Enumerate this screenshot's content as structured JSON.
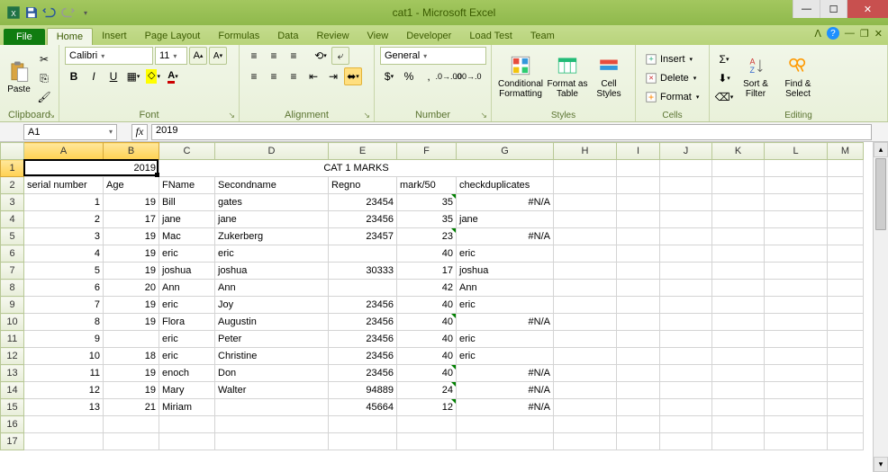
{
  "app": {
    "title": "cat1 - Microsoft Excel"
  },
  "tabs": {
    "file": "File",
    "items": [
      "Home",
      "Insert",
      "Page Layout",
      "Formulas",
      "Data",
      "Review",
      "View",
      "Developer",
      "Load Test",
      "Team"
    ],
    "active": 0
  },
  "ribbon": {
    "clipboard": {
      "label": "Clipboard",
      "paste": "Paste"
    },
    "font": {
      "label": "Font",
      "family": "Calibri",
      "size": "11",
      "bold": "B",
      "italic": "I",
      "underline": "U"
    },
    "alignment": {
      "label": "Alignment"
    },
    "number": {
      "label": "Number",
      "format": "General"
    },
    "styles": {
      "label": "Styles",
      "cond": "Conditional Formatting",
      "table": "Format as Table",
      "cell": "Cell Styles"
    },
    "cells": {
      "label": "Cells",
      "insert": "Insert",
      "delete": "Delete",
      "format": "Format"
    },
    "editing": {
      "label": "Editing",
      "sort": "Sort & Filter",
      "find": "Find & Select"
    }
  },
  "fbar": {
    "cell": "A1",
    "formula": "2019"
  },
  "cols": [
    "A",
    "B",
    "C",
    "D",
    "E",
    "F",
    "G",
    "H",
    "I",
    "J",
    "K",
    "L",
    "M"
  ],
  "sheet": {
    "title_row": {
      "ab": "2019",
      "title": "CAT 1 MARKS"
    },
    "headers": [
      "serial number",
      "Age",
      "FName",
      "Secondname",
      "Regno",
      "mark/50",
      "checkduplicates"
    ],
    "rows": [
      {
        "sn": "1",
        "age": "19",
        "fn": "Bill",
        "sn2": "gates",
        "reg": "23454",
        "mark": "35",
        "dup": "#N/A",
        "tri": true,
        "dupR": true
      },
      {
        "sn": "2",
        "age": "17",
        "fn": "jane",
        "sn2": "jane",
        "reg": "23456",
        "mark": "35",
        "dup": "jane",
        "tri": false,
        "dupR": false
      },
      {
        "sn": "3",
        "age": "19",
        "fn": "Mac",
        "sn2": "Zukerberg",
        "reg": "23457",
        "mark": "23",
        "dup": "#N/A",
        "tri": true,
        "dupR": true
      },
      {
        "sn": "4",
        "age": "19",
        "fn": "eric",
        "sn2": "eric",
        "reg": "",
        "mark": "40",
        "dup": "eric",
        "tri": false,
        "dupR": false
      },
      {
        "sn": "5",
        "age": "19",
        "fn": "joshua",
        "sn2": "joshua",
        "reg": "30333",
        "mark": "17",
        "dup": "joshua",
        "tri": false,
        "dupR": false
      },
      {
        "sn": "6",
        "age": "20",
        "fn": "Ann",
        "sn2": "Ann",
        "reg": "",
        "mark": "42",
        "dup": "Ann",
        "tri": false,
        "dupR": false
      },
      {
        "sn": "7",
        "age": "19",
        "fn": "eric",
        "sn2": "Joy",
        "reg": "23456",
        "mark": "40",
        "dup": "eric",
        "tri": false,
        "dupR": false
      },
      {
        "sn": "8",
        "age": "19",
        "fn": "Flora",
        "sn2": "Augustin",
        "reg": "23456",
        "mark": "40",
        "dup": "#N/A",
        "tri": true,
        "dupR": true
      },
      {
        "sn": "9",
        "age": "",
        "fn": "eric",
        "sn2": "Peter",
        "reg": "23456",
        "mark": "40",
        "dup": "eric",
        "tri": false,
        "dupR": false
      },
      {
        "sn": "10",
        "age": "18",
        "fn": "eric",
        "sn2": "Christine",
        "reg": "23456",
        "mark": "40",
        "dup": "eric",
        "tri": false,
        "dupR": false
      },
      {
        "sn": "11",
        "age": "19",
        "fn": "enoch",
        "sn2": "Don",
        "reg": "23456",
        "mark": "40",
        "dup": "#N/A",
        "tri": true,
        "dupR": true
      },
      {
        "sn": "12",
        "age": "19",
        "fn": "Mary",
        "sn2": "Walter",
        "reg": "94889",
        "mark": "24",
        "dup": "#N/A",
        "tri": true,
        "dupR": true
      },
      {
        "sn": "13",
        "age": "21",
        "fn": "Miriam",
        "sn2": "",
        "reg": "45664",
        "mark": "12",
        "dup": "#N/A",
        "tri": true,
        "dupR": true
      }
    ]
  }
}
